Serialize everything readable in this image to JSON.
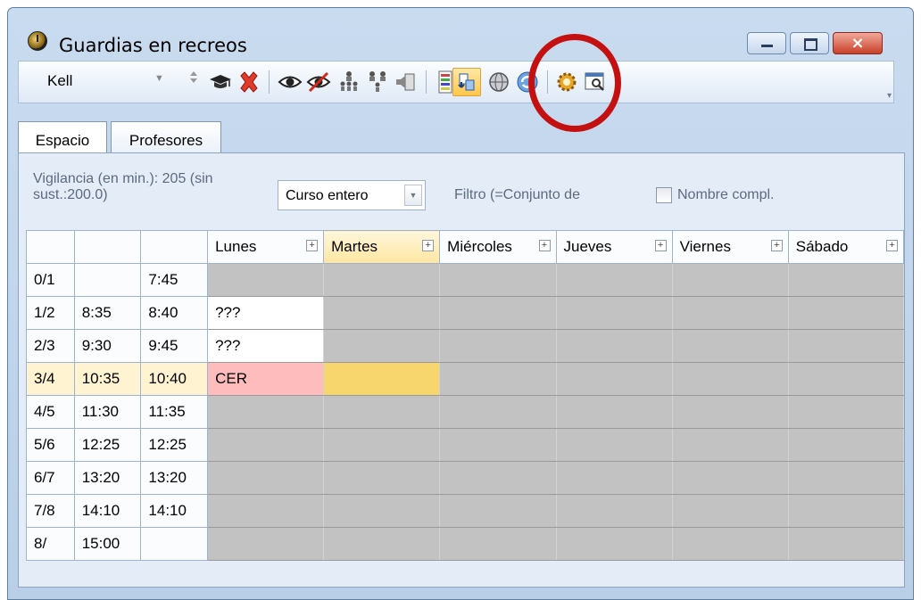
{
  "window": {
    "title": "Guardias en recreos",
    "app_icon": "clock-icon",
    "controls": [
      "minimize",
      "maximize",
      "close"
    ],
    "close_label": "×"
  },
  "toolbar": {
    "teacher_combo": "Kell",
    "icons": [
      "graduation-cap-icon",
      "delete-x-icon",
      "eye-icon",
      "eye-crossed-icon",
      "persons-tree-icon",
      "persons-tree-alt-icon",
      "speaker-icon",
      "grid-options-icon",
      "swap-arrows-icon",
      "globe-icon",
      "refresh-cycle-icon",
      "settings-gear-icon",
      "window-search-icon"
    ],
    "active_icon": "swap-arrows-icon"
  },
  "tabs": [
    {
      "label": "Espacio",
      "active": true
    },
    {
      "label": "Profesores",
      "active": false
    }
  ],
  "filters": {
    "vigilancia_line1": "Vigilancia (en min.): 205 (sin",
    "vigilancia_line2": "sust.:200.0)",
    "period_select": "Curso entero",
    "filtro_label": "Filtro (=Conjunto de",
    "nombre_checkbox_label": "Nombre compl.",
    "nombre_checked": false
  },
  "grid": {
    "days": [
      "Lunes",
      "Martes",
      "Miércoles",
      "Jueves",
      "Viernes",
      "Sábado"
    ],
    "highlight_day": "Martes",
    "rows": [
      {
        "period": "0/1",
        "start": "",
        "end": "7:45",
        "cells": [
          "",
          "",
          "",
          "",
          "",
          ""
        ],
        "states": [
          "gray",
          "gray",
          "gray",
          "gray",
          "gray",
          "gray"
        ]
      },
      {
        "period": "1/2",
        "start": "8:35",
        "end": "8:40",
        "cells": [
          "???",
          "",
          "",
          "",
          "",
          ""
        ],
        "states": [
          "white",
          "gray",
          "gray",
          "gray",
          "gray",
          "gray"
        ]
      },
      {
        "period": "2/3",
        "start": "9:30",
        "end": "9:45",
        "cells": [
          "???",
          "",
          "",
          "",
          "",
          ""
        ],
        "states": [
          "white",
          "gray",
          "gray",
          "gray",
          "gray",
          "gray"
        ]
      },
      {
        "period": "3/4",
        "start": "10:35",
        "end": "10:40",
        "cells": [
          "CER",
          "",
          "",
          "",
          "",
          ""
        ],
        "states": [
          "pink",
          "gold",
          "gray",
          "gray",
          "gray",
          "gray"
        ],
        "highlight": true
      },
      {
        "period": "4/5",
        "start": "11:30",
        "end": "11:35",
        "cells": [
          "",
          "",
          "",
          "",
          "",
          ""
        ],
        "states": [
          "gray",
          "gray",
          "gray",
          "gray",
          "gray",
          "gray"
        ]
      },
      {
        "period": "5/6",
        "start": "12:25",
        "end": "12:25",
        "cells": [
          "",
          "",
          "",
          "",
          "",
          ""
        ],
        "states": [
          "gray",
          "gray",
          "gray",
          "gray",
          "gray",
          "gray"
        ]
      },
      {
        "period": "6/7",
        "start": "13:20",
        "end": "13:20",
        "cells": [
          "",
          "",
          "",
          "",
          "",
          ""
        ],
        "states": [
          "gray",
          "gray",
          "gray",
          "gray",
          "gray",
          "gray"
        ]
      },
      {
        "period": "7/8",
        "start": "14:10",
        "end": "14:10",
        "cells": [
          "",
          "",
          "",
          "",
          "",
          ""
        ],
        "states": [
          "gray",
          "gray",
          "gray",
          "gray",
          "gray",
          "gray"
        ]
      },
      {
        "period": "8/",
        "start": "15:00",
        "end": "",
        "cells": [
          "",
          "",
          "",
          "",
          "",
          ""
        ],
        "states": [
          "gray",
          "gray",
          "gray",
          "gray",
          "gray",
          "gray"
        ]
      }
    ]
  },
  "colors": {
    "cell_gray": "#c2c2c2",
    "cell_pink": "#ffbcbc",
    "cell_gold": "#f7d66e",
    "annotation_ring": "#c41010"
  }
}
